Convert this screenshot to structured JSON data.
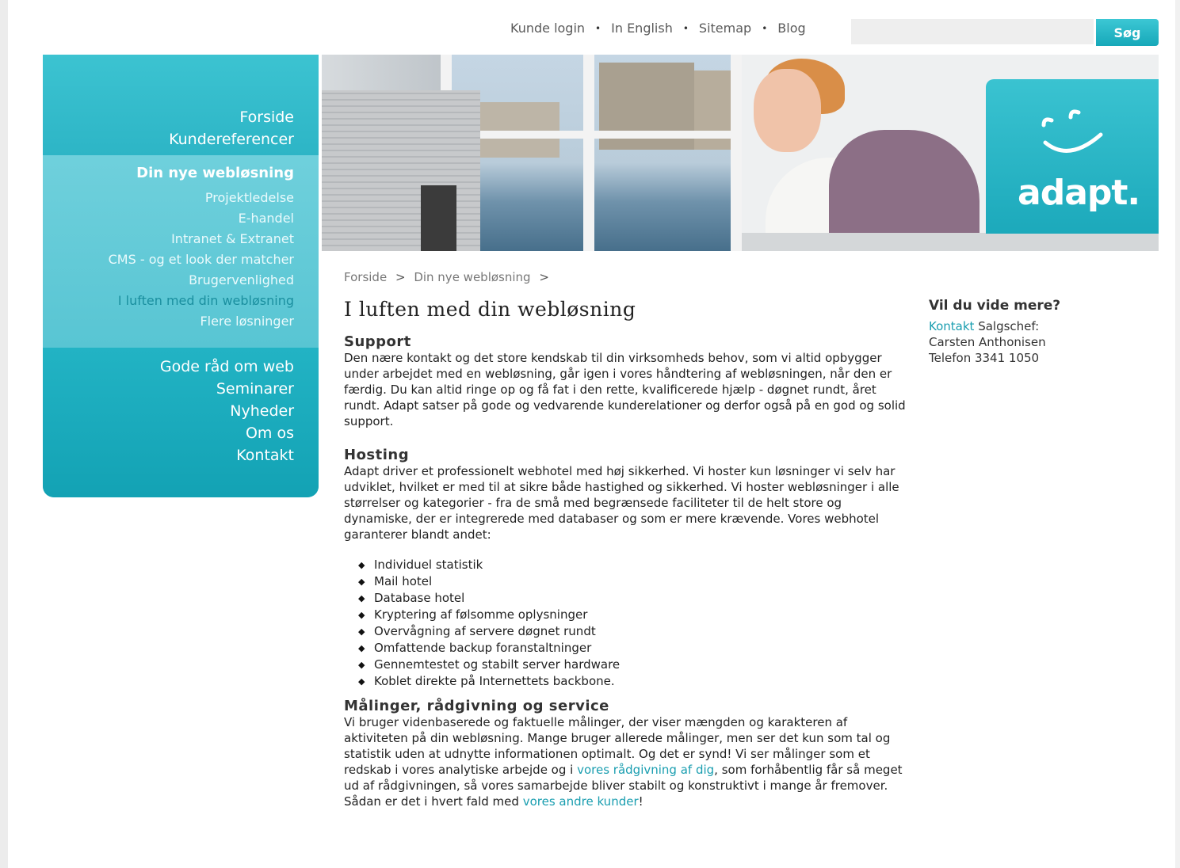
{
  "topnav": {
    "items": [
      "Kunde login",
      "In English",
      "Sitemap",
      "Blog"
    ],
    "separator": "•"
  },
  "search": {
    "value": "",
    "button_label": "Søg"
  },
  "sidebar": {
    "top_items": [
      "Forside",
      "Kundereferencer"
    ],
    "section_heading": "Din nye webløsning",
    "sub_items": [
      "Projektledelse",
      "E-handel",
      "Intranet & Extranet",
      "CMS - og et look der matcher",
      "Brugervenlighed",
      "I luften med din webløsning",
      "Flere løsninger"
    ],
    "active_sub_item": "I luften med din webløsning",
    "bottom_items": [
      "Gode råd om web",
      "Seminarer",
      "Nyheder",
      "Om os",
      "Kontakt"
    ]
  },
  "banner": {
    "logo_text": "adapt."
  },
  "breadcrumb": {
    "items": [
      "Forside",
      "Din nye webløsning"
    ],
    "separator": ">"
  },
  "content": {
    "title": "I luften med din webløsning",
    "support": {
      "heading": "Support",
      "text": "Den nære kontakt og det store kendskab til din virksomheds behov, som vi altid opbygger under arbejdet med en webløsning, går igen i vores håndtering af webløsningen, når den er færdig. Du kan altid ringe op og få fat i den rette, kvalificerede hjælp - døgnet rundt, året rundt. Adapt satser på gode og vedvarende kunderelationer og derfor også på en god og solid support."
    },
    "hosting": {
      "heading": "Hosting",
      "text": "Adapt driver et professionelt webhotel med høj sikkerhed. Vi hoster kun løsninger vi selv har udviklet, hvilket er med til at sikre både hastighed og sikkerhed. Vi hoster webløsninger i alle størrelser og kategorier - fra de små med begrænsede faciliteter til de helt store og dynamiske, der er integrerede med databaser og som er mere krævende. Vores webhotel garanterer blandt andet:",
      "bullets": [
        "Individuel statistik",
        "Mail hotel",
        "Database hotel",
        "Kryptering af følsomme oplysninger",
        "Overvågning af servere døgnet rundt",
        "Omfattende backup foranstaltninger",
        "Gennemtestet og stabilt server hardware",
        "Koblet direkte på Internettets backbone."
      ]
    },
    "maalinger": {
      "heading": "Målinger, rådgivning og service",
      "text_1": "Vi bruger videnbaserede og faktuelle målinger, der viser mængden og karakteren af aktiviteten på din webløsning. Mange bruger allerede målinger, men ser det kun som tal og statistik uden at udnytte informationen optimalt. Og det er synd! Vi ser målinger som et redskab i vores analytiske arbejde og i ",
      "link_1": "vores rådgivning af dig",
      "text_2": ", som forhåbentlig får så meget ud af rådgivningen, så vores samarbejde bliver stabilt og konstruktivt i mange år fremover. Sådan er det i hvert fald med ",
      "link_2": "vores andre kunder",
      "text_3": "!"
    }
  },
  "aside": {
    "title": "Vil du vide mere?",
    "link": "Kontakt",
    "role": " Salgschef:",
    "name": "Carsten Anthonisen",
    "phone": "Telefon 3341 1050"
  },
  "colors": {
    "accent": "#2fb9c9",
    "link": "#1a9eb0"
  }
}
